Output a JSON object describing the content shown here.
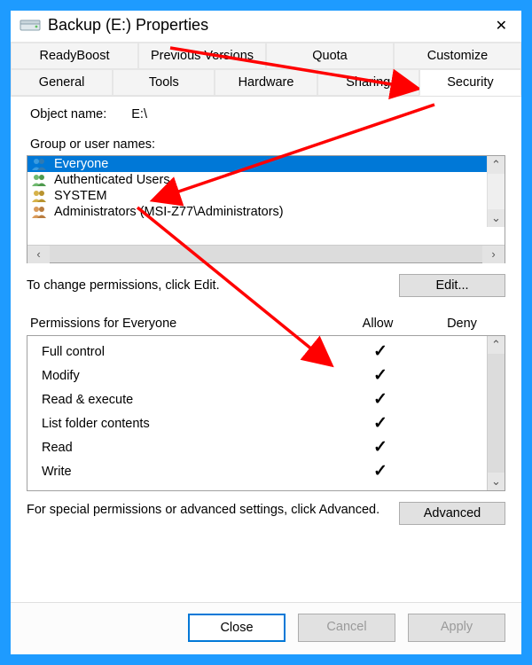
{
  "window": {
    "title": "Backup (E:) Properties"
  },
  "tabs": {
    "row1": [
      "ReadyBoost",
      "Previous Versions",
      "Quota",
      "Customize"
    ],
    "row2": [
      "General",
      "Tools",
      "Hardware",
      "Sharing",
      "Security"
    ],
    "active": "Security"
  },
  "object": {
    "label": "Object name:",
    "value": "E:\\"
  },
  "group_label": "Group or user names:",
  "users": [
    {
      "name": "Everyone",
      "selected": true
    },
    {
      "name": "Authenticated Users",
      "selected": false
    },
    {
      "name": "SYSTEM",
      "selected": false
    },
    {
      "name": "Administrators (MSI-Z77\\Administrators)",
      "selected": false
    }
  ],
  "edit_hint": "To change permissions, click Edit.",
  "edit_button": "Edit...",
  "perm_header": {
    "title": "Permissions for Everyone",
    "allow": "Allow",
    "deny": "Deny"
  },
  "permissions": [
    {
      "name": "Full control",
      "allow": true,
      "deny": false
    },
    {
      "name": "Modify",
      "allow": true,
      "deny": false
    },
    {
      "name": "Read & execute",
      "allow": true,
      "deny": false
    },
    {
      "name": "List folder contents",
      "allow": true,
      "deny": false
    },
    {
      "name": "Read",
      "allow": true,
      "deny": false
    },
    {
      "name": "Write",
      "allow": true,
      "deny": false
    }
  ],
  "advanced_hint": "For special permissions or advanced settings, click Advanced.",
  "advanced_button": "Advanced",
  "footer": {
    "close": "Close",
    "cancel": "Cancel",
    "apply": "Apply"
  }
}
